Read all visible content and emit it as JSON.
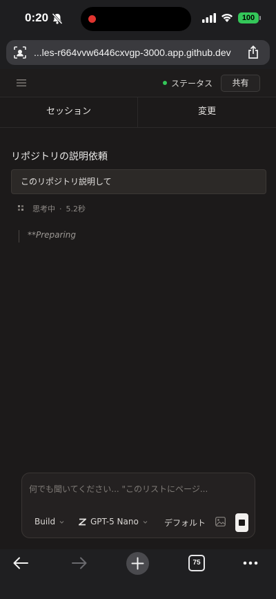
{
  "status_bar": {
    "time": "0:20",
    "battery": "100",
    "recording_dot_color": "#e0342f",
    "battery_color": "#34c759"
  },
  "browser": {
    "url": "...les-r664vvw6446cxvgp-3000.app.github.dev",
    "tab_count": "75"
  },
  "header": {
    "status_label": "ステータス",
    "status_color": "#34c759",
    "share_label": "共有"
  },
  "tabs": [
    {
      "label": "セッション"
    },
    {
      "label": "変更"
    }
  ],
  "session": {
    "title": "リポジトリの説明依頼",
    "user_message": "このリポジトリ説明して",
    "thinking_label": "思考中",
    "thinking_sep": "·",
    "thinking_time": "5.2秒",
    "preparing_text": "**Preparing"
  },
  "composer": {
    "placeholder": "何でも聞いてください... \"このリストにページ...",
    "mode_label": "Build",
    "model_label": "GPT-5 Nano",
    "variant_label": "デフォルト"
  }
}
